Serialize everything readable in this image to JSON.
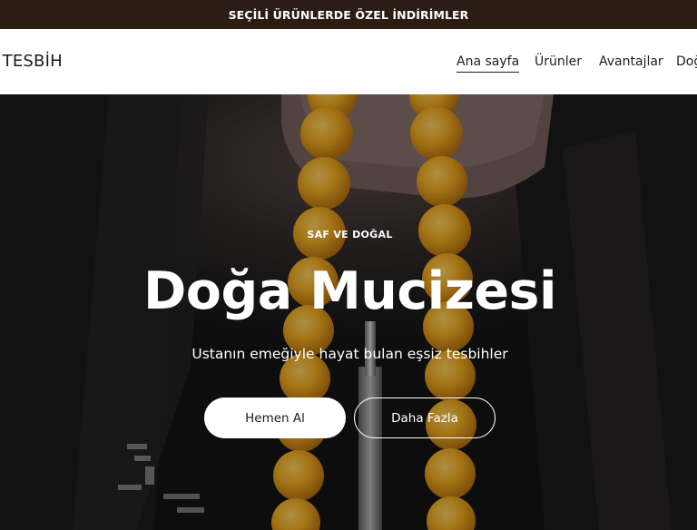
{
  "announcement": {
    "text": "SEÇİLİ ÜRÜNLERDE ÖZEL İNDİRİMLER"
  },
  "header": {
    "logo": "R TESBİH",
    "nav": [
      {
        "label": "Ana sayfa",
        "active": true
      },
      {
        "label": "Ürünler"
      },
      {
        "label": "Avantajlar"
      },
      {
        "label": "Doğ"
      }
    ]
  },
  "hero": {
    "eyebrow": "SAF VE DOĞAL",
    "title": "Doğa Mucizesi",
    "subtitle": "Ustanın emeğiyle hayat bulan eşsiz tesbihler",
    "primary_button": "Hemen Al",
    "secondary_button": "Daha Fazla",
    "image_subject": "prayer-beads-amber"
  },
  "colors": {
    "announcement_bg": "#2b1d14",
    "header_bg": "#ffffff",
    "bead": "#f0a91c",
    "text_light": "#ffffff",
    "text_dark": "#1b1b1b"
  }
}
